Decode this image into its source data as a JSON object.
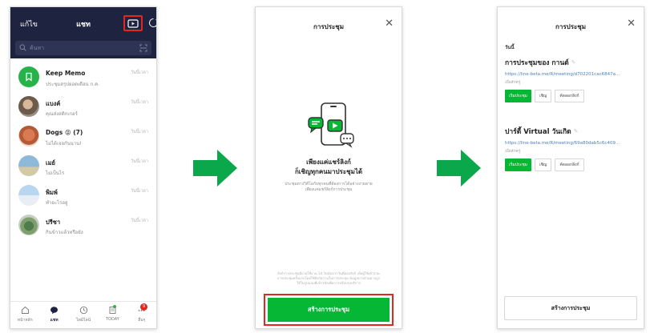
{
  "colors": {
    "navy": "#1e2340",
    "line_green": "#06b736",
    "highlight_red": "#e0281f",
    "arrow_green": "#0aa84a"
  },
  "chat_screen": {
    "header": {
      "edit_label": "แก้ไข",
      "title": "แชท",
      "meeting_icon": "video-meeting-icon",
      "new_chat_icon": "new-chat-icon"
    },
    "search": {
      "placeholder": "ค้นหา"
    },
    "chats": [
      {
        "name": "Keep Memo",
        "message": "ประชุมสรุปยอดเดือน ก.ค.",
        "time": "วันนี้เวลา",
        "avatar_icon": "bookmark-icon"
      },
      {
        "name": "แบงค์",
        "message": "คุณส่งสติกเกอร์",
        "time": "วันนี้เวลา",
        "avatar_icon": "person-photo"
      },
      {
        "name": "Dogs 😝 (7)",
        "message": "ไม่ได้เจอกันนาน!",
        "time": "วันนี้เวลา",
        "avatar_icon": "dog-photo"
      },
      {
        "name": "เมย์",
        "message": "ไม่เป็นไร",
        "time": "วันนี้เวลา",
        "avatar_icon": "beach-photo"
      },
      {
        "name": "พิมพ์",
        "message": "ทำอะไรอยู่",
        "time": "วันนี้เวลา",
        "avatar_icon": "person-photo"
      },
      {
        "name": "ปรีชา",
        "message": "กินข้าวแล้วหรือยัง",
        "time": "วันนี้เวลา",
        "avatar_icon": "plant-photo"
      }
    ],
    "tabs": [
      {
        "label": "หน้าหลัก",
        "icon": "home-icon"
      },
      {
        "label": "แชท",
        "icon": "chat-icon"
      },
      {
        "label": "ไทม์ไลน์",
        "icon": "clock-icon"
      },
      {
        "label": "TODAY",
        "icon": "news-icon"
      },
      {
        "label": "อื่นๆ",
        "icon": "more-icon",
        "badge": "9"
      }
    ]
  },
  "intro_screen": {
    "title": "การประชุม",
    "headline_line1": "เพียงแค่แชร์ลิงก์",
    "headline_line2": "ก็เชิญทุกคนมาประชุมได้",
    "description_line1": "ประชุมทางวิดีโอกับทุกคนที่ต้องการได้อย่างง่ายดาย",
    "description_line2": "เพียงแค่แชร์ลิงก์การประชุม",
    "note_line1": "ลิงก์การประชุมมีอายุใช้งาน 14 วันนับจากวันที่ออกลิงก์ เมื่อผู้ใช้เข้าร่วม",
    "note_line2": "การประชุมครั้งแรกโดยใช้ลิงก์ความในการประชุม ข้อมูลบางส่วนอาจถูก",
    "note_line3": "ใช้ในรูปแบบที่เข้ารหัสเพื่อการปรับปรุงบริการ",
    "create_button": "สร้างการประชุม"
  },
  "meetings_screen": {
    "title": "การประชุม",
    "date_label": "วันนี้",
    "meetings": [
      {
        "name": "การประชุมของ กานต์",
        "link": "https://line-beta.me/R/meeting/d702201cac6847a...",
        "meta": "เมื่อสักครู่",
        "start_label": "เริ่มประชุม",
        "invite_label": "เชิญ",
        "copy_label": "คัดลอกลิงก์"
      },
      {
        "name": "ปาร์ตี้ Virtual วันเกิด",
        "link": "https://line-beta.me/R/meeting/69a80dab5c6c409...",
        "meta": "เมื่อสักครู่",
        "start_label": "เริ่มประชุม",
        "invite_label": "เชิญ",
        "copy_label": "คัดลอกลิงก์"
      }
    ],
    "create_button": "สร้างการประชุม"
  }
}
